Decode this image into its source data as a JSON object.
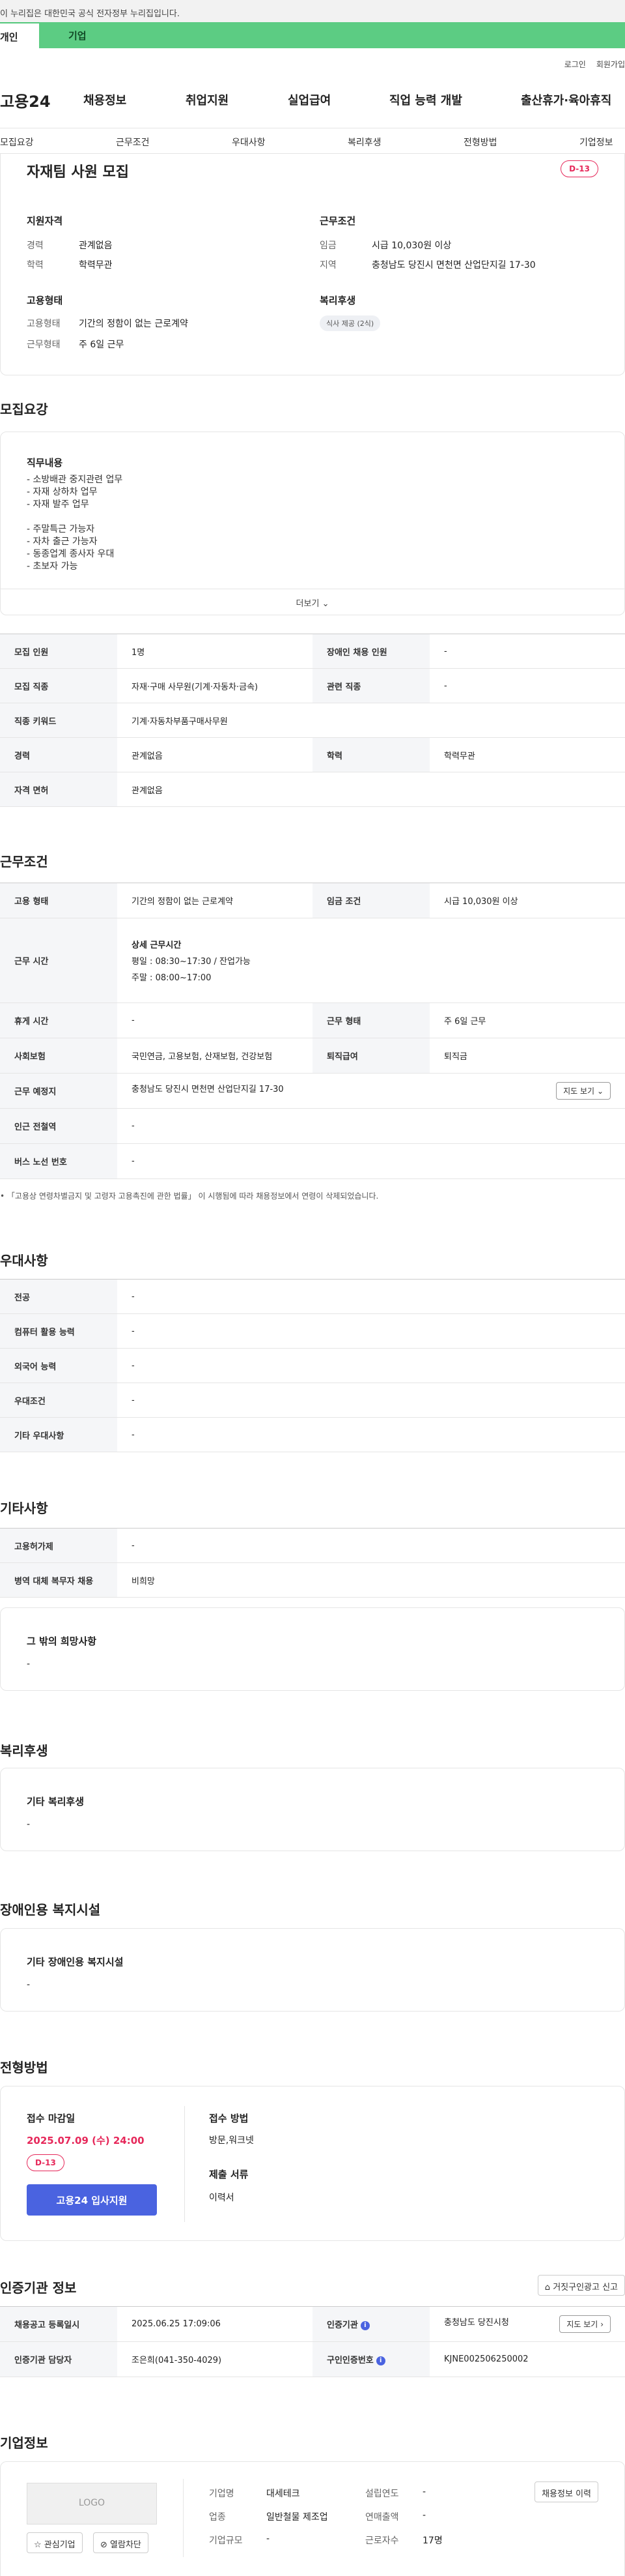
{
  "gov_banner": "이 누리집은 대한민국 공식 전자정부 누리집입니다.",
  "tabs": {
    "individual": "개인",
    "corporate": "기업"
  },
  "util": {
    "login": "로그인",
    "signup": "회원가입"
  },
  "gnb": {
    "logo": "고용24",
    "items": [
      "채용정보",
      "취업지원",
      "실업급여",
      "직업 능력 개발",
      "출산휴가·육아휴직"
    ]
  },
  "subnav": [
    "모집요강",
    "근무조건",
    "우대사항",
    "복리후생",
    "전형방법",
    "기업정보"
  ],
  "job": {
    "title": "자재팀 사원 모집",
    "dday": "D-13",
    "qual_title": "지원자격",
    "qual": [
      {
        "label": "경력",
        "value": "관계없음"
      },
      {
        "label": "학력",
        "value": "학력무관"
      }
    ],
    "cond_title": "근무조건",
    "cond": [
      {
        "label": "임금",
        "value": "시급 10,030원 이상"
      },
      {
        "label": "지역",
        "value": "충청남도 당진시 면천면 산업단지길 17-30"
      }
    ],
    "emp_title": "고용형태",
    "emp": [
      {
        "label": "고용형태",
        "value": "기간의 정함이 없는 근로계약"
      },
      {
        "label": "근무형태",
        "value": "주 6일 근무"
      }
    ],
    "welfare_title": "복리후생",
    "welfare_chip": "식사 제공 (2식)"
  },
  "recruit": {
    "section": "모집요강",
    "duty_title": "직무내용",
    "duty_lines": [
      "- 소방배관 중지관련 업무",
      "- 자재 상하차 업무",
      "- 자재 발주 업무",
      "",
      "- 주말특근 가능자",
      "- 자차 출근 가능자",
      "- 동종업계 종사자 우대",
      "- 초보자 가능"
    ],
    "more": "더보기",
    "table": {
      "headcount_label": "모집 인원",
      "headcount": "1명",
      "disabled_label": "장애인 채용 인원",
      "disabled": "-",
      "job_label": "모집 직종",
      "job": "자재·구매 사무원(기계·자동차·금속)",
      "related_label": "관련 직종",
      "related": "-",
      "keyword_label": "직종 키워드",
      "keyword": "기계·자동차부품구매사무원",
      "career_label": "경력",
      "career": "관계없음",
      "edu_label": "학력",
      "edu": "학력무관",
      "license_label": "자격 면허",
      "license": "관계없음"
    }
  },
  "work": {
    "section": "근무조건",
    "type_label": "고용 형태",
    "type": "기간의 정함이 없는 근로계약",
    "wage_label": "임금 조건",
    "wage": "시급 10,030원 이상",
    "hours_label": "근무 시간",
    "hours_title": "상세 근무시간",
    "hours_weekday": "평일 : 08:30~17:30 / 잔업가능",
    "hours_weekend": "주말 : 08:00~17:00",
    "rest_label": "휴게 시간",
    "rest": "-",
    "form_label": "근무 형태",
    "form": "주 6일 근무",
    "insurance_label": "사회보험",
    "insurance": "국민연금, 고용보험, 산재보험, 건강보험",
    "severance_label": "퇴직급여",
    "severance": "퇴직금",
    "place_label": "근무 예정지",
    "place": "충청남도 당진시 면천면 산업단지길 17-30",
    "map_btn": "지도 보기",
    "subway_label": "인근 전철역",
    "subway": "-",
    "bus_label": "버스 노선 번호",
    "bus": "-",
    "note": "「고용상 연령차별금지 및 고령자 고용촉진에 관한 법률」 이 시행됨에 따라 채용정보에서 연령이 삭제되었습니다."
  },
  "pref": {
    "section": "우대사항",
    "rows": [
      {
        "label": "전공",
        "value": "-"
      },
      {
        "label": "컴퓨터 활용 능력",
        "value": "-"
      },
      {
        "label": "외국어 능력",
        "value": "-"
      },
      {
        "label": "우대조건",
        "value": "-"
      },
      {
        "label": "기타 우대사항",
        "value": "-"
      }
    ]
  },
  "etc": {
    "section": "기타사항",
    "rows": [
      {
        "label": "고용허가제",
        "value": "-"
      },
      {
        "label": "병역 대체 복무자 채용",
        "value": "비희망"
      }
    ],
    "other_title": "그 밖의 희망사항",
    "other_value": "-"
  },
  "benefits": {
    "section": "복리후생",
    "title": "기타 복리후생",
    "value": "-"
  },
  "disabled_facility": {
    "section": "장애인용 복지시설",
    "title": "기타 장애인용 복지시설",
    "value": "-"
  },
  "process": {
    "section": "전형방법",
    "deadline_title": "접수 마감일",
    "deadline": "2025.07.09 (수) 24:00",
    "dday": "D-13",
    "apply_btn": "고용24 입사지원",
    "method_title": "접수 방법",
    "method": "방문,워크넷",
    "docs_title": "제출 서류",
    "docs": "이력서"
  },
  "agency": {
    "section": "인증기관 정보",
    "report_btn": "거짓구인광고 신고",
    "reg_label": "채용공고 등록일시",
    "reg": "2025.06.25 17:09:06",
    "org_label": "인증기관",
    "org": "충청남도 당진시청",
    "map_btn": "지도 보기",
    "manager_label": "인증기관 담당자",
    "manager": "조은희(041-350-4029)",
    "no_label": "구인인증번호",
    "no": "KJNE002506250002"
  },
  "company": {
    "section": "기업정보",
    "logo": "LOGO",
    "fav_btn": "관심기업",
    "block_btn": "열람차단",
    "history_btn": "채용정보 이력",
    "name_label": "기업명",
    "name": "대세테크",
    "year_label": "설립연도",
    "year": "-",
    "industry_label": "업종",
    "industry": "일반철물 제조업",
    "sales_label": "연매출액",
    "sales": "-",
    "size_label": "기업규모",
    "size": "-",
    "staff_label": "근로자수",
    "staff": "17명"
  }
}
